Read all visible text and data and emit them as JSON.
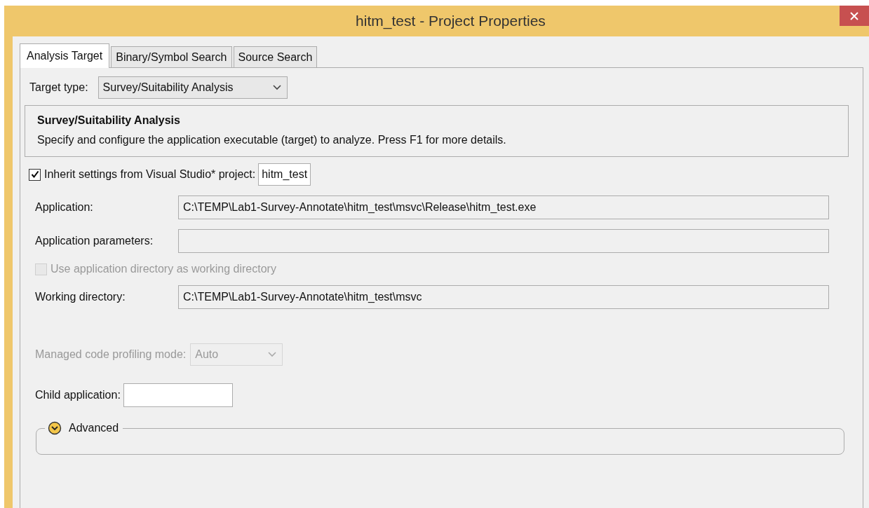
{
  "window": {
    "title": "hitm_test - Project Properties"
  },
  "tabs": [
    {
      "label": "Analysis Target",
      "selected": true
    },
    {
      "label": "Binary/Symbol Search",
      "selected": false
    },
    {
      "label": "Source Search",
      "selected": false
    }
  ],
  "target_type": {
    "label": "Target type:",
    "value": "Survey/Suitability Analysis"
  },
  "description": {
    "title": "Survey/Suitability Analysis",
    "text": "Specify and configure the application executable (target) to analyze. Press F1 for more details."
  },
  "inherit": {
    "label": "Inherit settings from Visual Studio* project:",
    "checked": true,
    "value": "hitm_test"
  },
  "rows": [
    {
      "kind": "field",
      "label": "Application:",
      "value": "C:\\TEMP\\Lab1-Survey-Annotate\\hitm_test\\msvc\\Release\\hitm_test.exe"
    },
    {
      "kind": "field",
      "label": "Application parameters:"
    },
    {
      "kind": "checkbox",
      "label": "Use application directory as working directory",
      "checked": false,
      "disabled": true
    },
    {
      "kind": "field",
      "label": "Working directory:",
      "value": "C:\\TEMP\\Lab1-Survey-Annotate\\hitm_test\\msvc"
    },
    {
      "kind": "dropdown",
      "label": "Managed code profiling mode:",
      "value": "Auto",
      "disabled": true
    },
    {
      "kind": "short_field",
      "label": "Child application:"
    }
  ],
  "advanced": {
    "label": "Advanced",
    "expanded": false
  }
}
